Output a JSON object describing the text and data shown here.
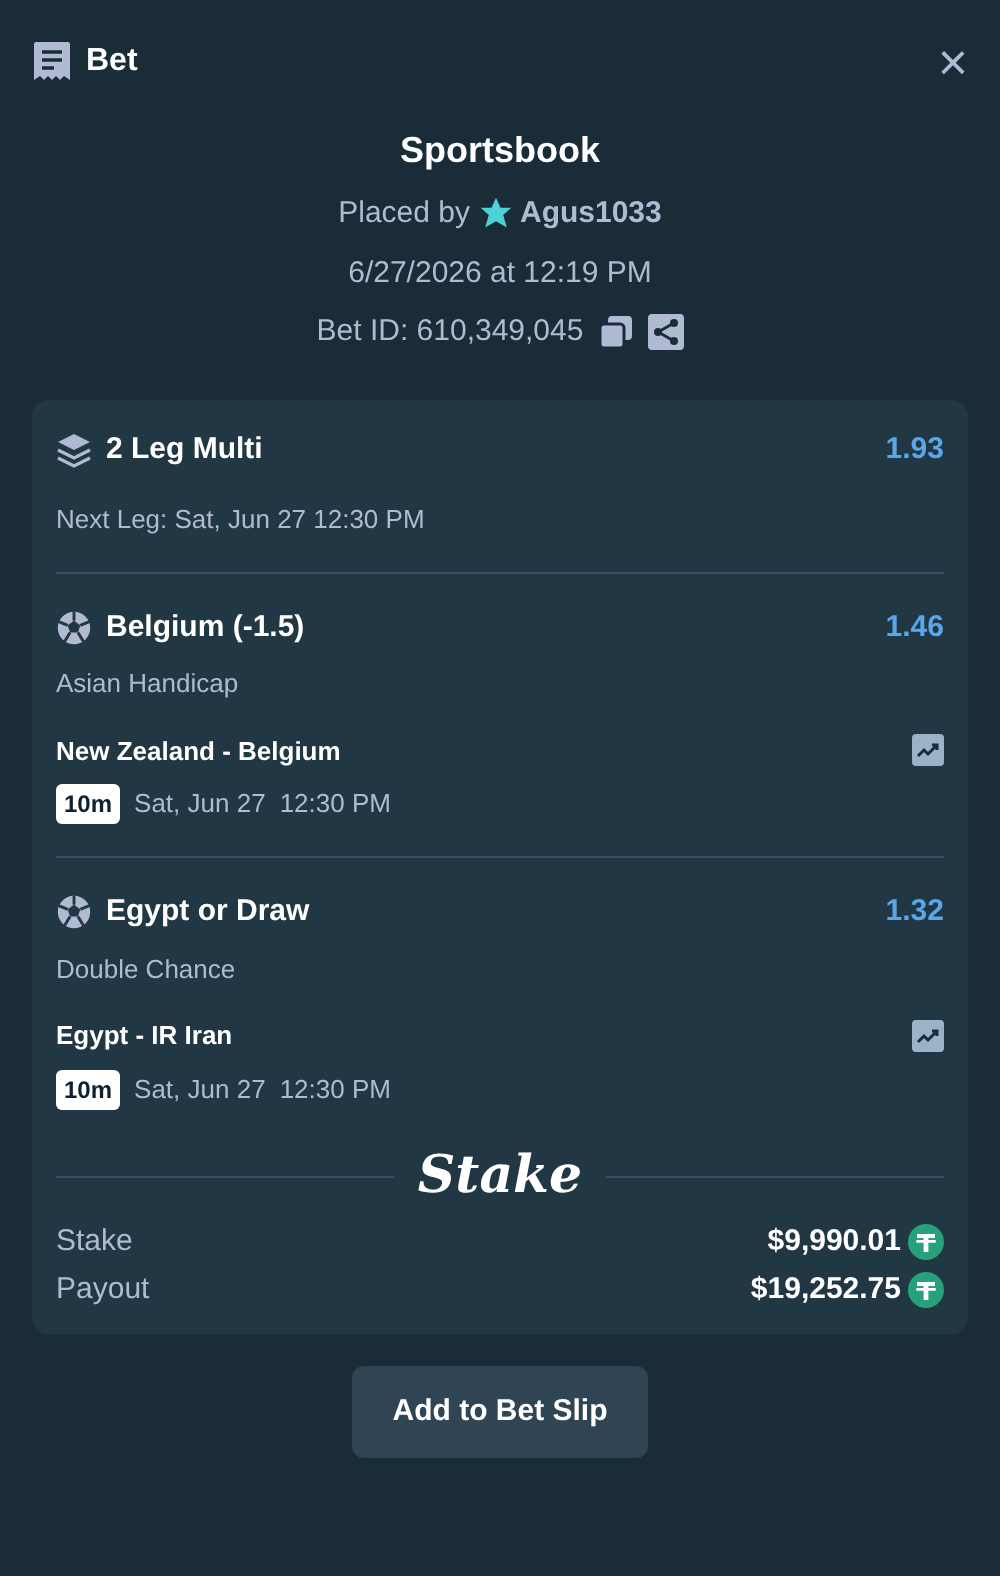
{
  "header": {
    "title": "Bet",
    "close": "×"
  },
  "summary": {
    "title": "Sportsbook",
    "placed_by": "Placed by",
    "user": "Agus1033",
    "datetime": "6/27/2026 at 12:19 PM",
    "bet_id": "Bet ID: 610,349,045"
  },
  "multi": {
    "title": "2 Leg Multi",
    "odds": "1.93",
    "next_leg": "Next Leg: Sat, Jun 27 12:30 PM"
  },
  "legs": [
    {
      "selection": "Belgium (-1.5)",
      "odds": "1.46",
      "market": "Asian Handicap",
      "match": "New Zealand - Belgium",
      "badge": "10m",
      "date": "Sat, Jun 27",
      "time": "12:30 PM"
    },
    {
      "selection": "Egypt or Draw",
      "odds": "1.32",
      "market": "Double Chance",
      "match": "Egypt - IR Iran",
      "badge": "10m",
      "date": "Sat, Jun 27",
      "time": "12:30 PM"
    }
  ],
  "brand": "Stake",
  "totals": [
    {
      "label": "Stake",
      "amount": "$9,990.01"
    },
    {
      "label": "Payout",
      "amount": "$19,252.75"
    }
  ],
  "button": "Add to Bet Slip"
}
